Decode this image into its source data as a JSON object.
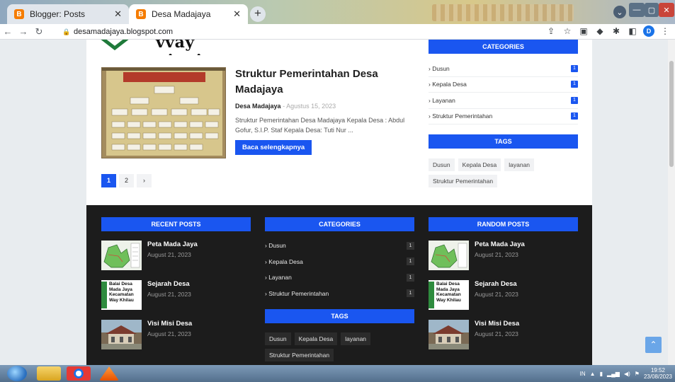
{
  "browser": {
    "tabs": [
      {
        "title": "Blogger: Posts",
        "active": false
      },
      {
        "title": "Desa Madajaya",
        "active": true
      }
    ],
    "url": "desamadajaya.blogspot.com",
    "profile_initial": "D"
  },
  "header": {
    "logo_text": "vvay ninai"
  },
  "post": {
    "title": "Struktur Pemerintahan Desa Madajaya",
    "author": "Desa Madajaya",
    "date": "Agustus 15, 2023",
    "excerpt": "Struktur Pemerintahan Desa Madajaya Kepala Desa : Abdul Gofur, S.I.P. Staf Kepala Desa: Tuti Nur ...",
    "read_more": "Baca selengkapnya"
  },
  "pagination": {
    "pages": [
      "1",
      "2"
    ],
    "next": "›"
  },
  "sidebar": {
    "categories_title": "CATEGORIES",
    "categories": [
      {
        "label": "Dusun",
        "count": "1"
      },
      {
        "label": "Kepala Desa",
        "count": "1"
      },
      {
        "label": "Layanan",
        "count": "1"
      },
      {
        "label": "Struktur Pemerintahan",
        "count": "1"
      }
    ],
    "tags_title": "TAGS",
    "tags": [
      "Dusun",
      "Kepala Desa",
      "layanan",
      "Struktur Pemerintahan"
    ]
  },
  "footer": {
    "recent_title": "RECENT POSTS",
    "recent_posts": [
      {
        "title": "Peta Mada Jaya",
        "date": "August 21, 2023"
      },
      {
        "title": "Sejarah Desa",
        "date": "August 21, 2023"
      },
      {
        "title": "Visi Misi Desa",
        "date": "August 21, 2023"
      }
    ],
    "categories_title": "CATEGORIES",
    "categories": [
      {
        "label": "Dusun",
        "count": "1"
      },
      {
        "label": "Kepala Desa",
        "count": "1"
      },
      {
        "label": "Layanan",
        "count": "1"
      },
      {
        "label": "Struktur Pemerintahan",
        "count": "1"
      }
    ],
    "tags_title": "TAGS",
    "tags": [
      "Dusun",
      "Kepala Desa",
      "layanan",
      "Struktur Pemerintahan"
    ],
    "random_title": "RANDOM POSTS",
    "random_posts": [
      {
        "title": "Peta Mada Jaya",
        "date": "August 21, 2023"
      },
      {
        "title": "Sejarah Desa",
        "date": "August 21, 2023"
      },
      {
        "title": "Visi Misi Desa",
        "date": "August 21, 2023"
      }
    ],
    "sejarah_thumb_lines": [
      "Balai Desa",
      "Mada Jaya",
      "Kecamatan",
      "Way Khilau"
    ]
  },
  "taskbar": {
    "language": "IN",
    "time": "19:52",
    "date": "23/08/2023"
  },
  "colors": {
    "accent": "#1a56f0",
    "footer_bg": "#1c1c1c"
  }
}
